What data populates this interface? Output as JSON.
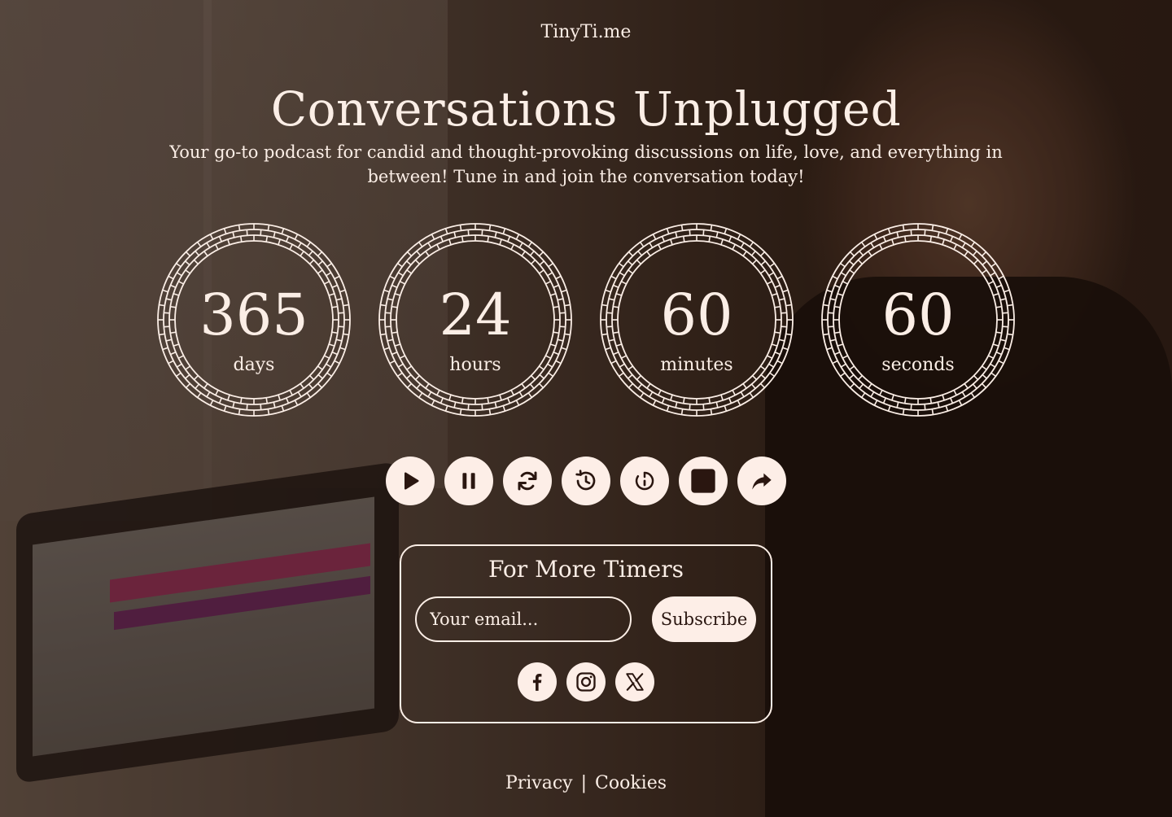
{
  "brand": "TinyTi.me",
  "title": "Conversations Unplugged",
  "subtitle": "Your go-to podcast for candid and thought-provoking discussions on life, love, and everything in between! Tune in and join the conversation today!",
  "timers": [
    {
      "value": "365",
      "unit": "days"
    },
    {
      "value": "24",
      "unit": "hours"
    },
    {
      "value": "60",
      "unit": "minutes"
    },
    {
      "value": "60",
      "unit": "seconds"
    }
  ],
  "controls": [
    {
      "icon": "play-icon"
    },
    {
      "icon": "pause-icon"
    },
    {
      "icon": "refresh-icon"
    },
    {
      "icon": "history-icon"
    },
    {
      "icon": "timer-icon"
    },
    {
      "icon": "stop-icon"
    },
    {
      "icon": "share-icon"
    }
  ],
  "subscribe_panel": {
    "title": "For More Timers",
    "email_placeholder": "Your email...",
    "button_label": "Subscribe",
    "socials": [
      "facebook-icon",
      "instagram-icon",
      "x-icon"
    ]
  },
  "footer": {
    "privacy": "Privacy",
    "separator": "|",
    "cookies": "Cookies"
  },
  "colors": {
    "text": "#fbeee6",
    "button_bg": "#fdeee7",
    "icon_dark": "#2a1610"
  }
}
